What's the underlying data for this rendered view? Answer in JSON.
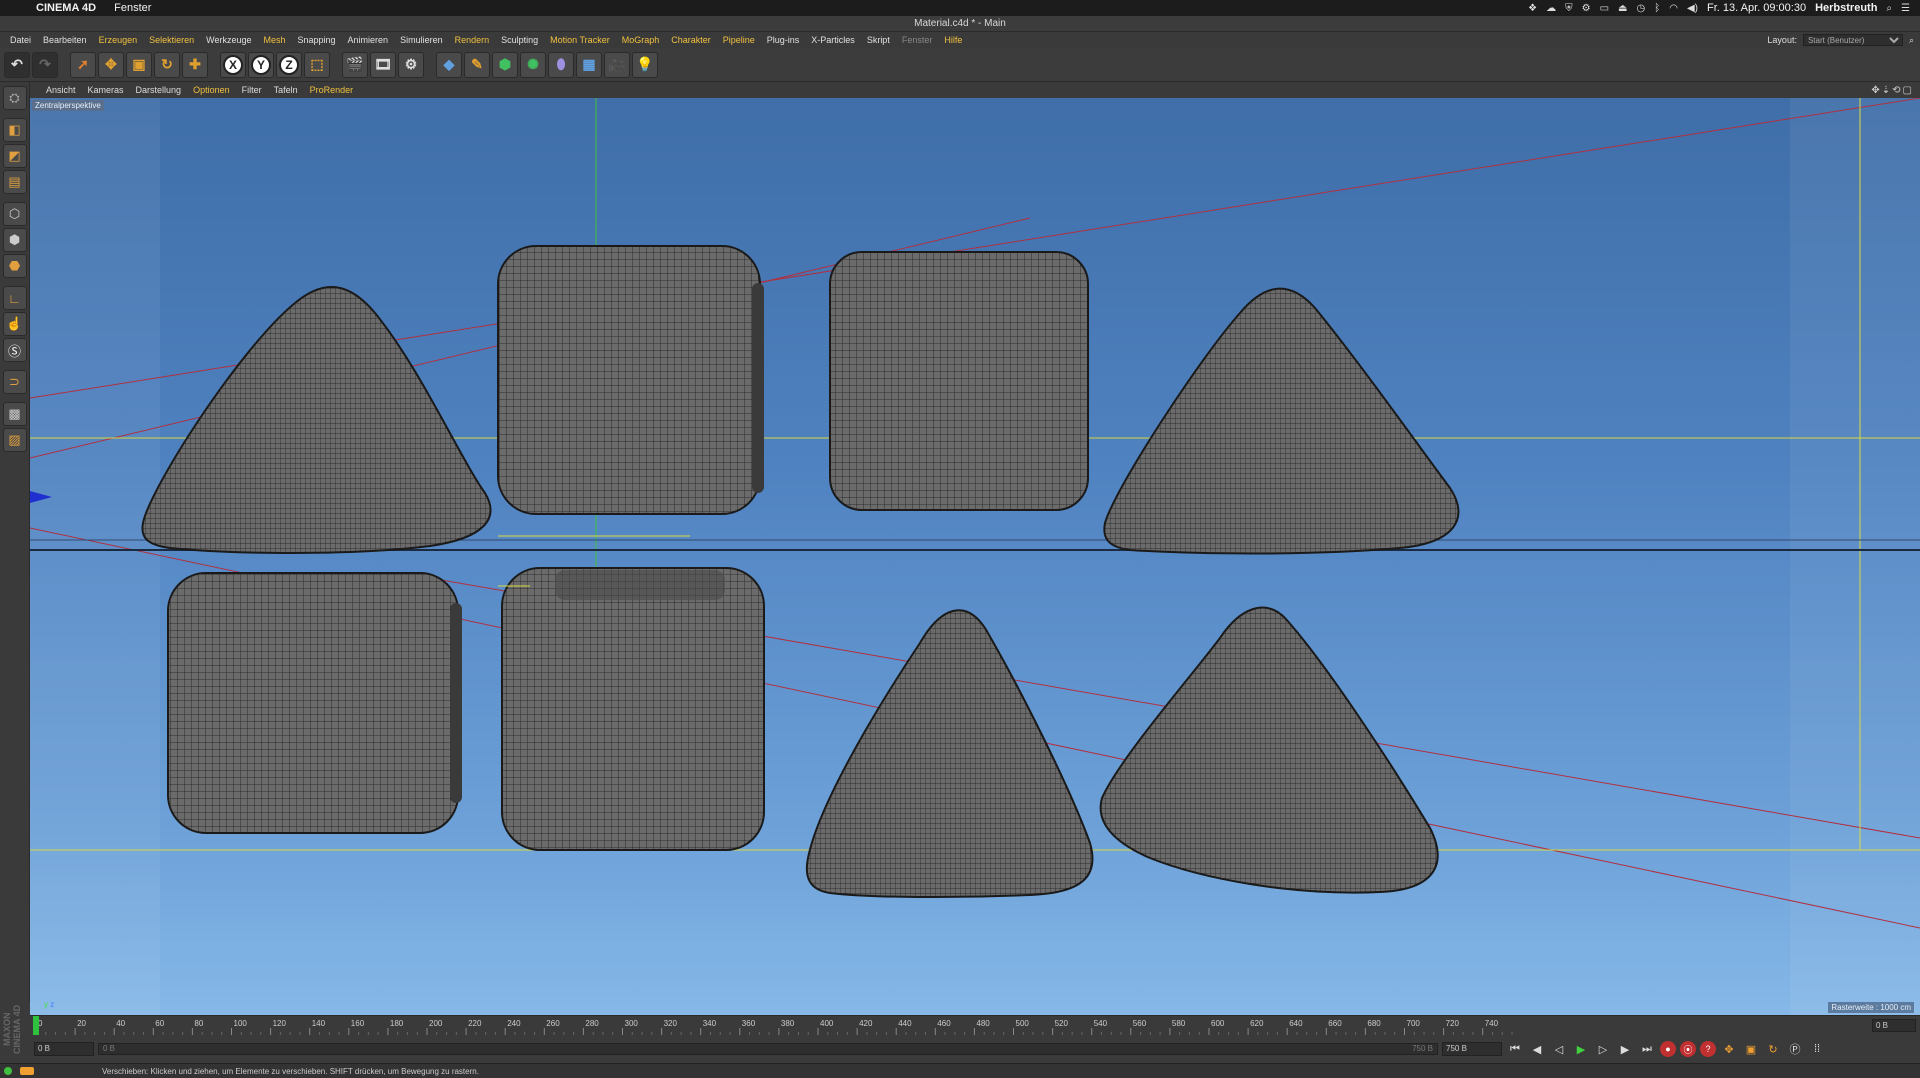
{
  "macos": {
    "apple": "",
    "app_name": "CINEMA 4D",
    "menu": "Fenster",
    "datetime": "Fr. 13. Apr.  09:00:30",
    "user": "Herbstreuth"
  },
  "window_title": "Material.c4d * - Main",
  "menubar": {
    "items": [
      {
        "label": "Datei",
        "style": "normal"
      },
      {
        "label": "Bearbeiten",
        "style": "normal"
      },
      {
        "label": "Erzeugen",
        "style": "hl"
      },
      {
        "label": "Selektieren",
        "style": "hl"
      },
      {
        "label": "Werkzeuge",
        "style": "normal"
      },
      {
        "label": "Mesh",
        "style": "hl"
      },
      {
        "label": "Snapping",
        "style": "normal"
      },
      {
        "label": "Animieren",
        "style": "normal"
      },
      {
        "label": "Simulieren",
        "style": "normal"
      },
      {
        "label": "Rendern",
        "style": "hl"
      },
      {
        "label": "Sculpting",
        "style": "normal"
      },
      {
        "label": "Motion Tracker",
        "style": "hl"
      },
      {
        "label": "MoGraph",
        "style": "hl"
      },
      {
        "label": "Charakter",
        "style": "hl"
      },
      {
        "label": "Pipeline",
        "style": "hl"
      },
      {
        "label": "Plug-ins",
        "style": "normal"
      },
      {
        "label": "X-Particles",
        "style": "normal"
      },
      {
        "label": "Skript",
        "style": "normal"
      },
      {
        "label": "Fenster",
        "style": "dim"
      },
      {
        "label": "Hilfe",
        "style": "hl"
      }
    ],
    "layout_label": "Layout:",
    "layout_value": "Start (Benutzer)"
  },
  "viewport_menu": {
    "items": [
      {
        "label": "Ansicht",
        "style": "normal"
      },
      {
        "label": "Kameras",
        "style": "normal"
      },
      {
        "label": "Darstellung",
        "style": "normal"
      },
      {
        "label": "Optionen",
        "style": "hl"
      },
      {
        "label": "Filter",
        "style": "normal"
      },
      {
        "label": "Tafeln",
        "style": "normal"
      },
      {
        "label": "ProRender",
        "style": "hl"
      }
    ]
  },
  "viewport": {
    "camera_label": "Zentralperspektive",
    "grid_info": "Rasterweite : 1000 cm",
    "axis_label": "y\nz"
  },
  "toolbar": {
    "axis_x": "X",
    "axis_y": "Y",
    "axis_z": "Z"
  },
  "timeline": {
    "ticks": [
      "0",
      "20",
      "40",
      "60",
      "80",
      "100",
      "120",
      "140",
      "160",
      "180",
      "200",
      "220",
      "240",
      "260",
      "280",
      "300",
      "320",
      "340",
      "360",
      "380",
      "400",
      "420",
      "440",
      "460",
      "480",
      "500",
      "520",
      "540",
      "560",
      "580",
      "600",
      "620",
      "640",
      "660",
      "680",
      "700",
      "720",
      "740"
    ],
    "end_frame": "0 B"
  },
  "transport": {
    "current_frame": "0 B",
    "start_field": "0 B",
    "scrub_end": "750 B",
    "end_field": "750 B"
  },
  "branding": "MAXON CINEMA 4D",
  "status_text": "Verschieben: Klicken und ziehen, um Elemente zu verschieben. SHIFT drücken, um Bewegung zu rastern."
}
